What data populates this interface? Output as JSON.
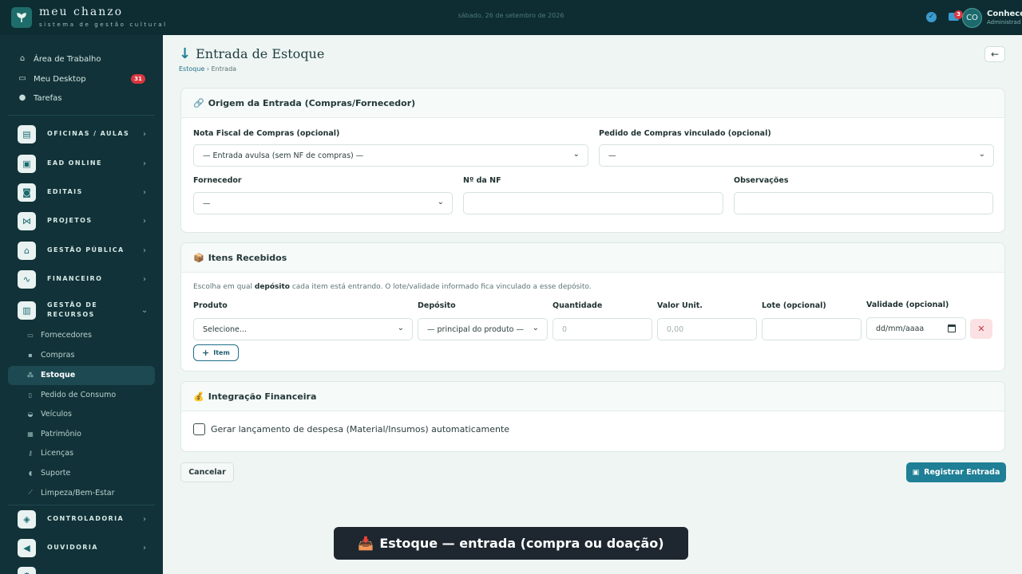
{
  "app": {
    "title": "meu chanzo",
    "subtitle": "sistema de gestão cultural",
    "date": "sábado, 26 de setembro de 2026"
  },
  "topbar": {
    "mail_count": "3",
    "avatar_initials": "CO",
    "user_name": "Conhece",
    "user_role": "Administrad"
  },
  "sidebar": {
    "top_items": [
      {
        "label": "Área de Trabalho",
        "icon": "home-icon"
      },
      {
        "label": "Meu Desktop",
        "icon": "monitor-icon",
        "badge": "31"
      },
      {
        "label": "Tarefas",
        "icon": "check-circle-icon"
      }
    ],
    "groups": [
      {
        "label": "OFICINAS / AULAS",
        "icon": "classroom-icon"
      },
      {
        "label": "EAD ONLINE",
        "icon": "laptop-icon"
      },
      {
        "label": "EDITAIS",
        "icon": "chat-icon"
      },
      {
        "label": "PROJETOS",
        "icon": "network-icon"
      },
      {
        "label": "GESTÃO PÚBLICA",
        "icon": "building-icon"
      },
      {
        "label": "FINANCEIRO",
        "icon": "chart-icon"
      },
      {
        "label": "GESTÃO DE RECURSOS",
        "icon": "resources-icon"
      }
    ],
    "sub_items": [
      {
        "label": "Fornecedores",
        "icon": "truck-icon"
      },
      {
        "label": "Compras",
        "icon": "cart-icon"
      },
      {
        "label": "Estoque",
        "icon": "boxes-icon",
        "active": true
      },
      {
        "label": "Pedido de Consumo",
        "icon": "clipboard-icon"
      },
      {
        "label": "Veículos",
        "icon": "car-icon"
      },
      {
        "label": "Patrimônio",
        "icon": "landmark-icon"
      },
      {
        "label": "Licenças",
        "icon": "key-icon"
      },
      {
        "label": "Suporte",
        "icon": "headset-icon"
      },
      {
        "label": "Limpeza/Bem-Estar",
        "icon": "broom-icon"
      }
    ],
    "bottom_groups": [
      {
        "label": "CONTROLADORIA",
        "icon": "shield-icon"
      },
      {
        "label": "OUVIDORIA",
        "icon": "megaphone-icon"
      }
    ]
  },
  "page": {
    "title": "Entrada de Estoque",
    "breadcrumb_root": "Estoque",
    "breadcrumb_current": "Entrada"
  },
  "origem": {
    "header": "Origem da Entrada (Compras/Fornecedor)",
    "nf_label": "Nota Fiscal de Compras (opcional)",
    "nf_value": "— Entrada avulsa (sem NF de compras) —",
    "pedido_label": "Pedido de Compras vinculado (opcional)",
    "pedido_value": "—",
    "fornecedor_label": "Fornecedor",
    "fornecedor_value": "—",
    "num_nf_label": "Nº da NF",
    "obs_label": "Observações"
  },
  "itens": {
    "header": "Itens Recebidos",
    "hint_pre": "Escolha em qual ",
    "hint_bold": "depósito",
    "hint_post": " cada item está entrando. O lote/validade informado fica vinculado a esse depósito.",
    "columns": [
      "Produto",
      "Depósito",
      "Quantidade",
      "Valor Unit.",
      "Lote (opcional)",
      "Validade (opcional)"
    ],
    "row": {
      "produto": "Selecione...",
      "deposito": "— principal do produto —",
      "quantidade_placeholder": "0",
      "valor_placeholder": "0,00",
      "validade_placeholder": "dd/mm/aaaa"
    },
    "add_label": "Item"
  },
  "financeira": {
    "header": "Integração Financeira",
    "checkbox_label": "Gerar lançamento de despesa (Material/Insumos) automaticamente"
  },
  "actions": {
    "cancel": "Cancelar",
    "submit": "Registrar Entrada"
  },
  "toast": {
    "text": "Estoque — entrada (compra ou doação)"
  },
  "colors": {
    "topbar": "#0d2d33",
    "sidebar": "#113238",
    "accent": "#1f7f96",
    "danger": "#d9363e"
  }
}
